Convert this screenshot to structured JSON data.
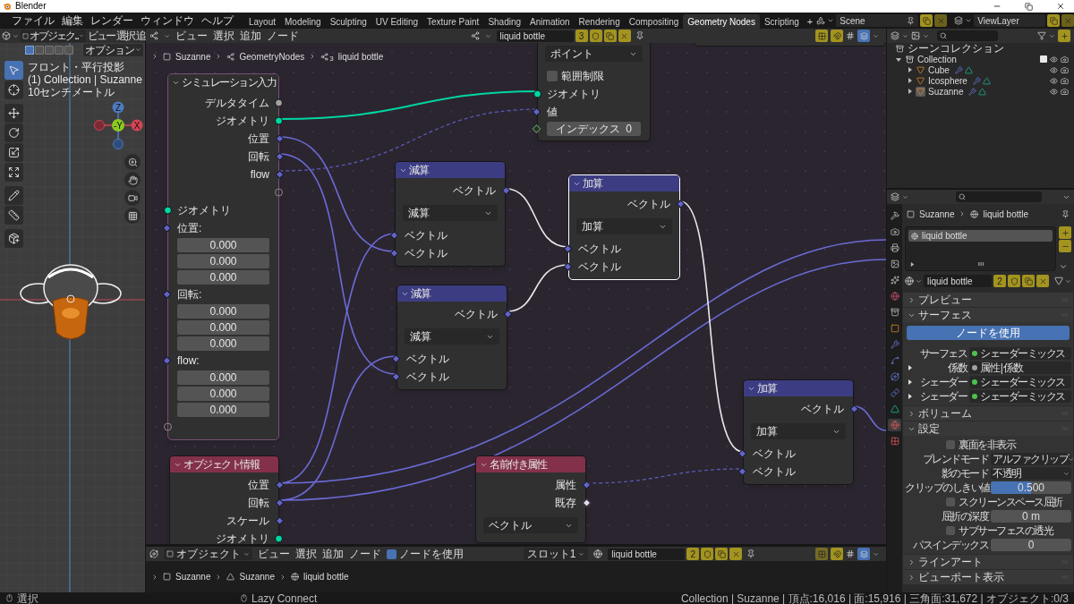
{
  "window": {
    "title": "Blender"
  },
  "menus": [
    "ファイル",
    "編集",
    "レンダー",
    "ウィンドウ",
    "ヘルプ"
  ],
  "workspaces": [
    {
      "label": "Layout",
      "selected": false
    },
    {
      "label": "Modeling",
      "selected": false
    },
    {
      "label": "Sculpting",
      "selected": false
    },
    {
      "label": "UV Editing",
      "selected": false
    },
    {
      "label": "Texture Paint",
      "selected": false
    },
    {
      "label": "Shading",
      "selected": false
    },
    {
      "label": "Animation",
      "selected": false
    },
    {
      "label": "Rendering",
      "selected": false
    },
    {
      "label": "Compositing",
      "selected": false
    },
    {
      "label": "Geometry Nodes",
      "selected": true
    },
    {
      "label": "Scripting",
      "selected": false
    }
  ],
  "add_workspace": "+",
  "scene": {
    "name": "Scene"
  },
  "view_layer": {
    "name": "ViewLayer"
  },
  "viewport": {
    "mode": "オブジェク...",
    "menus": [
      "ビュー",
      "選択",
      "追"
    ],
    "options": "オプション",
    "select_modes": [
      {
        "selected": true
      },
      {
        "selected": false
      },
      {
        "selected": false
      },
      {
        "selected": false
      },
      {
        "selected": false
      }
    ],
    "overlay": [
      "フロント・平行投影",
      "(1) Collection | Suzanne",
      "10センチメートル"
    ],
    "gizmo": {
      "z": "Z",
      "y": "-Y",
      "x": "X"
    },
    "tools": [
      {
        "selected": true
      },
      {
        "selected": false
      },
      {
        "selected": false
      },
      {
        "selected": false
      },
      {
        "selected": false
      },
      {
        "selected": false
      },
      {
        "selected": false
      },
      {
        "selected": false
      },
      {
        "selected": false
      }
    ]
  },
  "node_editor": {
    "menus": [
      "ビュー",
      "選択",
      "追加",
      "ノード"
    ],
    "tree": {
      "name": "liquid bottle",
      "users": "3"
    },
    "breadcrumb": [
      {
        "label": "Suzanne"
      },
      {
        "label": "GeometryNodes"
      },
      {
        "label": "liquid bottle",
        "count": "3"
      }
    ],
    "nodes": [
      {
        "kind": "zone",
        "title": "シミュレーション入力",
        "color": "#2f2f2f",
        "selected": false,
        "rows": [
          {
            "kind": "output",
            "label": "デルタタイム",
            "socket": {
              "kind": "float"
            }
          },
          {
            "kind": "output",
            "label": "ジオメトリ",
            "socket": {
              "kind": "geometry"
            }
          },
          {
            "kind": "output",
            "label": "位置",
            "socket": {
              "kind": "vector"
            }
          },
          {
            "kind": "output",
            "label": "回転",
            "socket": {
              "kind": "vector"
            }
          },
          {
            "kind": "output",
            "label": "flow",
            "socket": {
              "kind": "vector"
            }
          },
          {
            "kind": "output",
            "socket": {
              "kind": "empty"
            }
          },
          {
            "kind": "input",
            "label": "ジオメトリ",
            "socket": {
              "kind": "geometry"
            }
          },
          {
            "kind": "input",
            "label": "位置:",
            "socket": {
              "kind": "vector"
            }
          },
          {
            "kind": "field",
            "value": "0.000"
          },
          {
            "kind": "field",
            "value": "0.000"
          },
          {
            "kind": "field",
            "value": "0.000"
          },
          {
            "kind": "input",
            "label": "回転:",
            "socket": {
              "kind": "vector"
            }
          },
          {
            "kind": "field",
            "value": "0.000"
          },
          {
            "kind": "field",
            "value": "0.000"
          },
          {
            "kind": "field",
            "value": "0.000"
          },
          {
            "kind": "input",
            "label": "flow:",
            "socket": {
              "kind": "vector"
            }
          },
          {
            "kind": "field",
            "value": "0.000"
          },
          {
            "kind": "field",
            "value": "0.000"
          },
          {
            "kind": "field",
            "value": "0.000"
          },
          {
            "kind": "input",
            "socket": {
              "kind": "empty"
            }
          }
        ]
      },
      {
        "kind": "node",
        "selected": false,
        "rows": [
          {
            "kind": "dropdown",
            "value": "ポイント"
          },
          {
            "kind": "checkbox",
            "label": "範囲制限",
            "checked": false
          },
          {
            "kind": "input",
            "label": "ジオメトリ",
            "socket": {
              "kind": "geometry"
            }
          },
          {
            "kind": "input",
            "label": "値",
            "socket": {
              "kind": "vector"
            }
          },
          {
            "kind": "field_input",
            "label": "インデックス",
            "value": "0",
            "socket": {
              "kind": "int"
            }
          }
        ]
      },
      {
        "kind": "node",
        "title": "減算",
        "color": "#3c3c83",
        "selected": false,
        "rows": [
          {
            "kind": "output",
            "label": "ベクトル",
            "socket": {
              "kind": "vector"
            }
          },
          {
            "kind": "dropdown",
            "value": "減算"
          },
          {
            "kind": "input",
            "label": "ベクトル",
            "socket": {
              "kind": "vector"
            }
          },
          {
            "kind": "input",
            "label": "ベクトル",
            "socket": {
              "kind": "vector"
            }
          }
        ]
      },
      {
        "kind": "node",
        "title": "減算",
        "color": "#3c3c83",
        "selected": false,
        "rows": [
          {
            "kind": "output",
            "label": "ベクトル",
            "socket": {
              "kind": "vector"
            }
          },
          {
            "kind": "dropdown",
            "value": "減算"
          },
          {
            "kind": "input",
            "label": "ベクトル",
            "socket": {
              "kind": "vector"
            }
          },
          {
            "kind": "input",
            "label": "ベクトル",
            "socket": {
              "kind": "vector"
            }
          }
        ]
      },
      {
        "kind": "node",
        "title": "加算",
        "color": "#3c3c83",
        "selected": true,
        "rows": [
          {
            "kind": "output",
            "label": "ベクトル",
            "socket": {
              "kind": "vector"
            }
          },
          {
            "kind": "dropdown",
            "value": "加算"
          },
          {
            "kind": "input",
            "label": "ベクトル",
            "socket": {
              "kind": "vector"
            }
          },
          {
            "kind": "input",
            "label": "ベクトル",
            "socket": {
              "kind": "vector"
            }
          }
        ]
      },
      {
        "kind": "node",
        "title": "加算",
        "color": "#3c3c83",
        "selected": false,
        "rows": [
          {
            "kind": "output",
            "label": "ベクトル",
            "socket": {
              "kind": "vector"
            }
          },
          {
            "kind": "dropdown",
            "value": "加算"
          },
          {
            "kind": "input",
            "label": "ベクトル",
            "socket": {
              "kind": "vector"
            }
          },
          {
            "kind": "input",
            "label": "ベクトル",
            "socket": {
              "kind": "vector"
            }
          }
        ]
      },
      {
        "kind": "node",
        "title": "オブジェクト情報",
        "color": "#83314a",
        "selected": false,
        "rows": [
          {
            "kind": "output",
            "label": "位置",
            "socket": {
              "kind": "vector"
            }
          },
          {
            "kind": "output",
            "label": "回転",
            "socket": {
              "kind": "vector"
            }
          },
          {
            "kind": "output",
            "label": "スケール",
            "socket": {
              "kind": "vector"
            }
          },
          {
            "kind": "output",
            "label": "ジオメトリ",
            "socket": {
              "kind": "geometry"
            }
          }
        ]
      },
      {
        "kind": "node",
        "title": "名前付き属性",
        "color": "#83314a",
        "selected": false,
        "rows": [
          {
            "kind": "output",
            "label": "属性",
            "socket": {
              "kind": "vector"
            }
          },
          {
            "kind": "output",
            "label": "既存",
            "socket": {
              "kind": "boolean"
            }
          },
          {
            "kind": "dropdown",
            "value": "ベクトル"
          }
        ]
      }
    ]
  },
  "shader_editor": {
    "mode": "オブジェクト",
    "menus": [
      "ビュー",
      "選択",
      "追加",
      "ノード"
    ],
    "use_nodes": {
      "label": "ノードを使用",
      "checked": true
    },
    "slot": "スロット1",
    "material": {
      "name": "liquid bottle",
      "users": "2"
    },
    "breadcrumb": [
      "Suzanne",
      "Suzanne",
      "liquid bottle"
    ]
  },
  "outliner": {
    "root": "シーンコレクション",
    "items": [
      {
        "label": "Collection",
        "expanded": true,
        "checked": true,
        "selected": false,
        "children": [
          {
            "label": "Cube",
            "expanded": false,
            "selected": false
          },
          {
            "label": "Icosphere",
            "expanded": false,
            "selected": false
          },
          {
            "label": "Suzanne",
            "expanded": false,
            "selected": true
          }
        ]
      }
    ]
  },
  "properties": {
    "tabs": [
      {
        "selected": false
      },
      {
        "selected": false
      },
      {
        "selected": false
      },
      {
        "selected": false
      },
      {
        "selected": false
      },
      {
        "selected": false
      },
      {
        "selected": false
      },
      {
        "selected": false
      },
      {
        "selected": false
      },
      {
        "selected": false
      },
      {
        "selected": false
      },
      {
        "selected": false
      },
      {
        "selected": false
      },
      {
        "selected": true
      },
      {
        "selected": false
      }
    ],
    "breadcrumb": [
      "Suzanne",
      "liquid bottle"
    ],
    "slots": [
      {
        "label": "liquid bottle",
        "selected": true
      }
    ],
    "material": {
      "name": "liquid bottle",
      "users": "2"
    },
    "panels": [
      {
        "title": "プレビュー",
        "expanded": false
      },
      {
        "title": "サーフェス",
        "expanded": true,
        "rows": [
          {
            "kind": "button",
            "label": "ノードを使用"
          },
          {
            "kind": "socket",
            "label": "サーフェス",
            "value": "シェーダーミックス",
            "color": "#4cc24c",
            "expandable": false
          },
          {
            "kind": "socket",
            "label": "係数",
            "value": "属性 | 係数",
            "color": "#a1a1a1",
            "expandable": true
          },
          {
            "kind": "socket",
            "label": "シェーダー",
            "value": "シェーダーミックス",
            "color": "#4cc24c",
            "expandable": true
          },
          {
            "kind": "socket",
            "label": "シェーダー",
            "value": "シェーダーミックス",
            "color": "#4cc24c",
            "expandable": true
          }
        ]
      },
      {
        "title": "ボリューム",
        "expanded": false
      },
      {
        "title": "設定",
        "expanded": true,
        "rows": [
          {
            "kind": "checkbox",
            "label": "裏面を非表示",
            "checked": false
          },
          {
            "kind": "dropdown",
            "label": "ブレンドモード",
            "value": "アルファクリップ"
          },
          {
            "kind": "dropdown",
            "label": "影のモード",
            "value": "不透明"
          },
          {
            "kind": "slider",
            "label": "クリップのしきい値",
            "value": "0.500",
            "level": 0.5
          },
          {
            "kind": "checkbox",
            "label": "スクリーンスペース屈折",
            "checked": false
          },
          {
            "kind": "number",
            "label": "屈折の深度",
            "value": "0 m"
          },
          {
            "kind": "checkbox",
            "label": "サブサーフェスの透光",
            "checked": false
          },
          {
            "kind": "number",
            "label": "パスインデックス",
            "value": "0"
          }
        ]
      },
      {
        "title": "ラインアート",
        "expanded": false
      },
      {
        "title": "ビューポート表示",
        "expanded": false
      }
    ]
  },
  "status_bar": {
    "hints": [
      "選択",
      "Lazy Connect"
    ],
    "stats": "Collection | Suzanne | 頂点:16,016 | 面:15,916 | 三角面:31,672 | オブジェクト:0/3"
  }
}
